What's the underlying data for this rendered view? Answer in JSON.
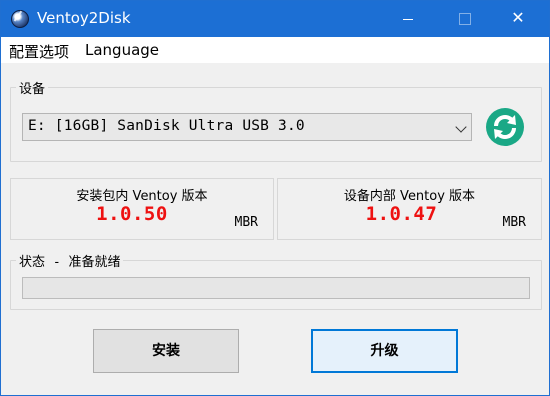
{
  "window": {
    "title": "Ventoy2Disk",
    "close_glyph": "✕"
  },
  "menu": {
    "config_label": "配置选项",
    "language_label": "Language"
  },
  "device": {
    "group_label": "设备",
    "selected": "E: [16GB] SanDisk Ultra USB 3.0",
    "refresh_icon": "refresh-icon"
  },
  "versions": {
    "package": {
      "title": "安装包内 Ventoy 版本",
      "value": "1.0.50",
      "partition_style": "MBR"
    },
    "device": {
      "title": "设备内部 Ventoy 版本",
      "value": "1.0.47",
      "partition_style": "MBR"
    }
  },
  "status": {
    "label": "状态 - 准备就绪",
    "progress": 0
  },
  "buttons": {
    "install_label": "安装",
    "update_label": "升级"
  },
  "colors": {
    "titlebar": "#1c6fd4",
    "version_text": "#ee1111",
    "refresh_bg": "#1aa886",
    "focus_border": "#0078d7"
  }
}
